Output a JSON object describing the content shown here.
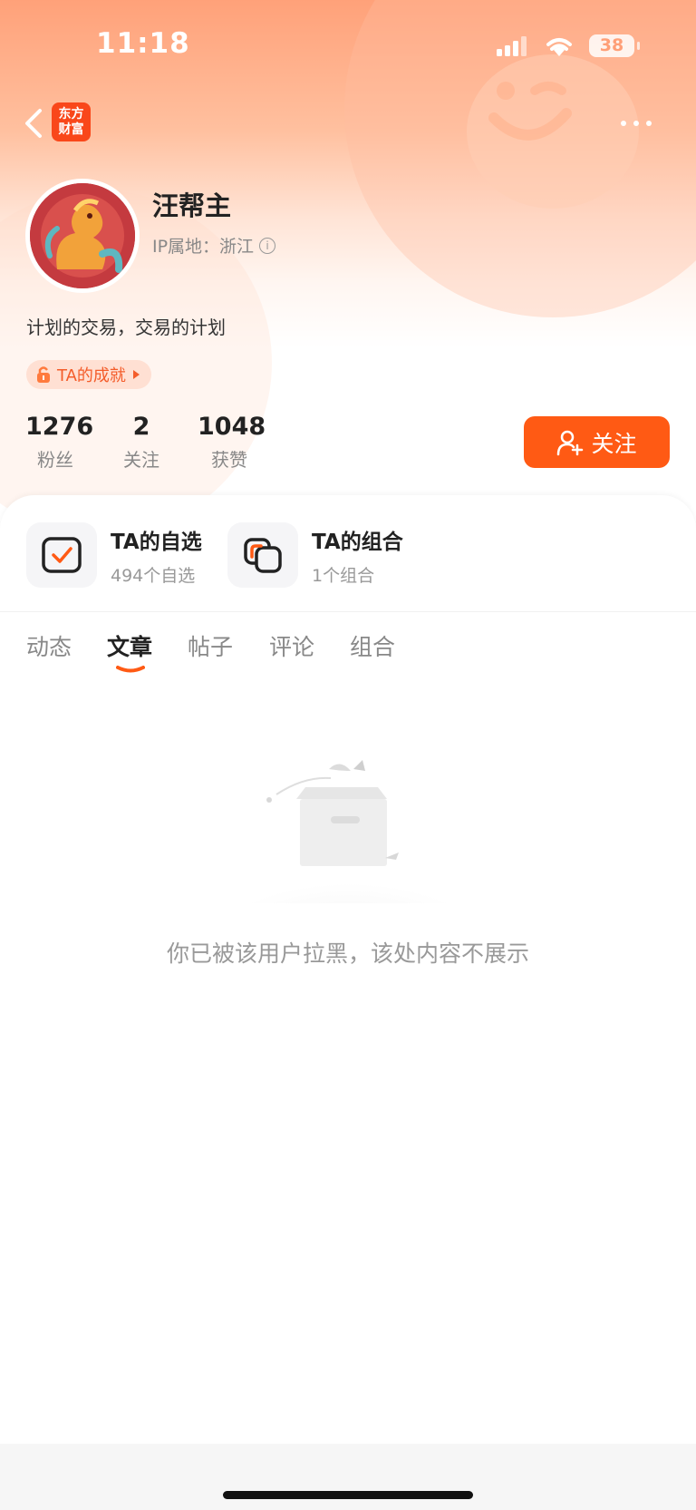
{
  "status_bar": {
    "time": "11:18",
    "battery": "38"
  },
  "header": {
    "logo_text_line1": "东方",
    "logo_text_line2": "财富"
  },
  "profile": {
    "name": "汪帮主",
    "ip_label": "IP属地：浙江",
    "bio": "计划的交易，交易的计划",
    "achievement_label": "TA的成就",
    "stats": [
      {
        "value": "1276",
        "label": "粉丝"
      },
      {
        "value": "2",
        "label": "关注"
      },
      {
        "value": "1048",
        "label": "获赞"
      }
    ],
    "follow_label": "关注"
  },
  "entries": [
    {
      "title": "TA的自选",
      "subtitle": "494个自选"
    },
    {
      "title": "TA的组合",
      "subtitle": "1个组合"
    }
  ],
  "tabs": [
    {
      "label": "动态"
    },
    {
      "label": "文章"
    },
    {
      "label": "帖子"
    },
    {
      "label": "评论"
    },
    {
      "label": "组合"
    }
  ],
  "active_tab": "文章",
  "empty_message": "你已被该用户拉黑，该处内容不展示",
  "colors": {
    "accent": "#ff5a14",
    "brand": "#f9471a"
  }
}
